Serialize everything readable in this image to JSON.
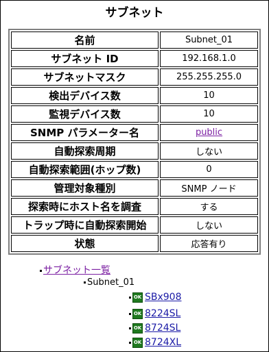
{
  "title": "サブネット",
  "properties": [
    {
      "key": "名前",
      "value": "Subnet_01"
    },
    {
      "key": "サブネット ID",
      "value": "192.168.1.0"
    },
    {
      "key": "サブネットマスク",
      "value": "255.255.255.0"
    },
    {
      "key": "検出デバイス数",
      "value": "10"
    },
    {
      "key": "監視デバイス数",
      "value": "10"
    },
    {
      "key": "SNMP パラメーター名",
      "value": "public"
    },
    {
      "key": "自動探索周期",
      "value": "しない"
    },
    {
      "key": "自動探索範囲(ホップ数)",
      "value": "0"
    },
    {
      "key": "管理対象種別",
      "value": "SNMP ノード"
    },
    {
      "key": "探索時にホスト名を調査",
      "value": "する"
    },
    {
      "key": "トラップ時に自動探索開始",
      "value": "しない"
    },
    {
      "key": "状態",
      "value": "応答有り"
    }
  ],
  "tree": {
    "root_link": "サブネット一覧",
    "subnet": "Subnet_01",
    "status_icon_label": "OK",
    "devices": [
      "SBx908",
      "8224SL",
      "8724SL",
      "8724XL"
    ]
  },
  "colors": {
    "visited_link": "#7b1fa2",
    "device_link": "#1a1aa6",
    "ok_icon": "#1f7a1f"
  }
}
